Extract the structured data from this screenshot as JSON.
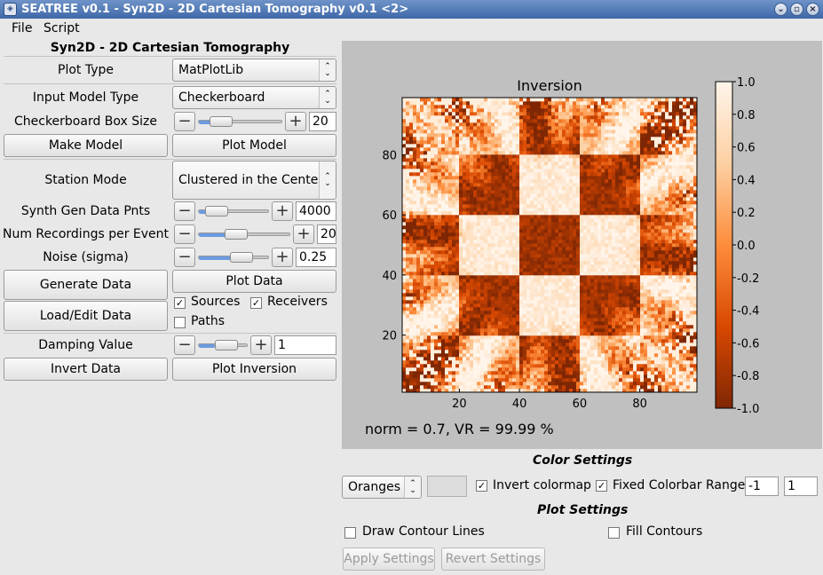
{
  "window": {
    "title": "SEATREE v0.1 - Syn2D - 2D Cartesian Tomography v0.1 <2>"
  },
  "menu": {
    "file": "File",
    "script": "Script"
  },
  "left": {
    "header": "Syn2D - 2D Cartesian Tomography",
    "plot_type_label": "Plot Type",
    "plot_type_value": "MatPlotLib",
    "input_model_label": "Input Model Type",
    "input_model_value": "Checkerboard",
    "box_size_label": "Checkerboard Box Size",
    "box_size_value": "20",
    "make_model": "Make Model",
    "plot_model": "Plot Model",
    "station_mode_label": "Station Mode",
    "station_mode_value": "Clustered in the Center",
    "synth_label": "Synth Gen Data Pnts",
    "synth_value": "4000",
    "num_rec_label": "Num Recordings per Event",
    "num_rec_value": "20",
    "noise_label": "Noise (sigma)",
    "noise_value": "0.25",
    "generate_data": "Generate Data",
    "plot_data": "Plot Data",
    "load_edit": "Load/Edit Data",
    "sources": "Sources",
    "receivers": "Receivers",
    "paths": "Paths",
    "damping_label": "Damping Value",
    "damping_value": "1",
    "invert_data": "Invert Data",
    "plot_inversion": "Plot Inversion",
    "sources_checked": true,
    "receivers_checked": true,
    "paths_checked": false
  },
  "plot": {
    "title": "Inversion",
    "xticks": [
      "20",
      "40",
      "60",
      "80"
    ],
    "yticks": [
      "20",
      "40",
      "60",
      "80"
    ],
    "colorbar_ticks": [
      "1.0",
      "0.8",
      "0.6",
      "0.4",
      "0.2",
      "0.0",
      "-0.2",
      "-0.4",
      "-0.6",
      "-0.8",
      "-1.0"
    ],
    "caption": "norm = 0.7, VR = 99.99 %",
    "colormap": "Oranges (inverted)",
    "colors": {
      "dark": "#7f2704",
      "light": "#fff5eb"
    }
  },
  "color_settings": {
    "header": "Color Settings",
    "colormap_value": "Oranges",
    "invert_label": "Invert colormap",
    "invert_checked": true,
    "fixed_label": "Fixed Colorbar Range",
    "fixed_checked": true,
    "min": "-1",
    "max": "1"
  },
  "plot_settings": {
    "header": "Plot Settings",
    "contour_lines": "Draw Contour Lines",
    "fill_contours": "Fill Contours",
    "apply": "Apply Settings",
    "revert": "Revert Settings"
  },
  "icons": [
    "app-icon",
    "chevron-down-icon",
    "restore-icon",
    "close-icon",
    "minus-icon",
    "plus-icon",
    "check-icon",
    "combo-arrow-icon"
  ]
}
